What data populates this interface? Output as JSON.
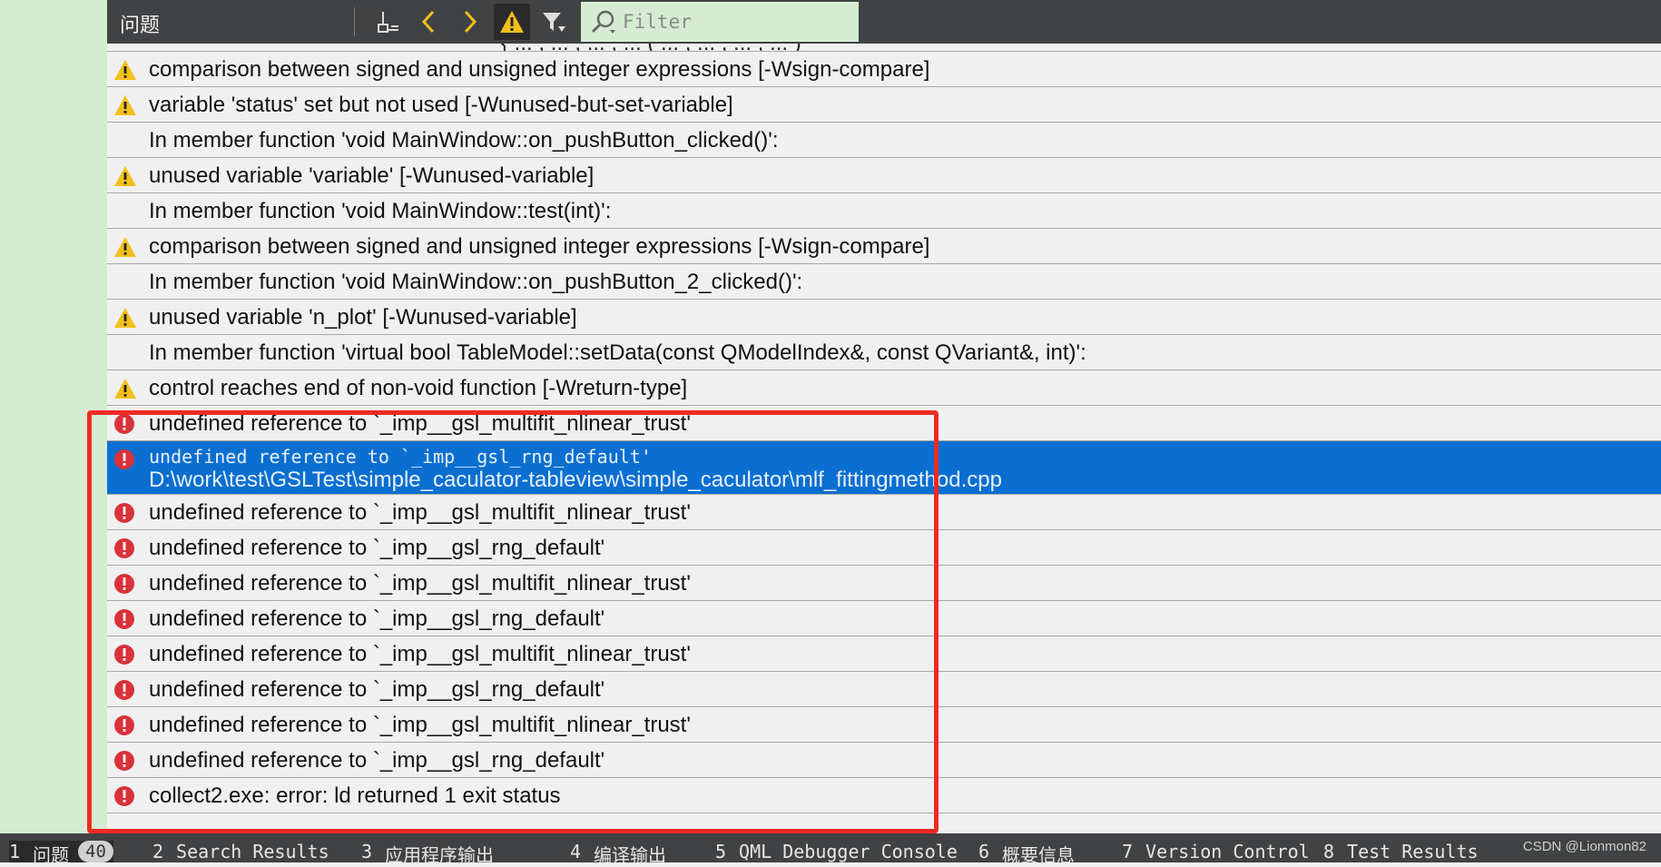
{
  "toolbar": {
    "title": "问题",
    "filter_placeholder": "Filter",
    "buttons": [
      "clean-icon",
      "chevron-left-icon",
      "chevron-right-icon",
      "warning-filter-icon",
      "filter-icon"
    ]
  },
  "issues": {
    "cutoff_text": "{  ...  ,  ...  ,  ...  ,  ...  (  ...  ,  ...  ,  ...  ,  ...  )",
    "rows": [
      {
        "type": "warning",
        "text": "comparison between signed and unsigned integer expressions [-Wsign-compare]"
      },
      {
        "type": "warning",
        "text": "variable 'status' set but not used [-Wunused-but-set-variable]"
      },
      {
        "type": "none",
        "text": "In member function 'void MainWindow::on_pushButton_clicked()':"
      },
      {
        "type": "warning",
        "text": "unused variable 'variable' [-Wunused-variable]"
      },
      {
        "type": "none",
        "text": "In member function 'void MainWindow::test(int)':"
      },
      {
        "type": "warning",
        "text": "comparison between signed and unsigned integer expressions [-Wsign-compare]"
      },
      {
        "type": "none",
        "text": "In member function 'void MainWindow::on_pushButton_2_clicked()':"
      },
      {
        "type": "warning",
        "text": "unused variable 'n_plot' [-Wunused-variable]"
      },
      {
        "type": "none",
        "text": "In member function 'virtual bool TableModel::setData(const QModelIndex&, const QVariant&, int)':"
      },
      {
        "type": "warning",
        "text": "control reaches end of non-void function [-Wreturn-type]"
      },
      {
        "type": "error",
        "text": "undefined reference to `_imp__gsl_multifit_nlinear_trust'"
      },
      {
        "type": "error",
        "selected": true,
        "text": "undefined reference to `_imp__gsl_rng_default'",
        "path": "D:\\work\\test\\GSLTest\\simple_caculator-tableview\\simple_caculator\\mlf_fittingmethod.cpp"
      },
      {
        "type": "error",
        "text": "undefined reference to `_imp__gsl_multifit_nlinear_trust'"
      },
      {
        "type": "error",
        "text": "undefined reference to `_imp__gsl_rng_default'"
      },
      {
        "type": "error",
        "text": "undefined reference to `_imp__gsl_multifit_nlinear_trust'"
      },
      {
        "type": "error",
        "text": "undefined reference to `_imp__gsl_rng_default'"
      },
      {
        "type": "error",
        "text": "undefined reference to `_imp__gsl_multifit_nlinear_trust'"
      },
      {
        "type": "error",
        "text": "undefined reference to `_imp__gsl_rng_default'"
      },
      {
        "type": "error",
        "text": "undefined reference to `_imp__gsl_multifit_nlinear_trust'"
      },
      {
        "type": "error",
        "text": "undefined reference to `_imp__gsl_rng_default'"
      },
      {
        "type": "error",
        "text": "collect2.exe: error: ld returned 1 exit status"
      }
    ]
  },
  "statusbar": {
    "tabs": [
      {
        "num": "1",
        "label": "问题",
        "badge": "40",
        "active": true
      },
      {
        "num": "2",
        "label": "Search Results"
      },
      {
        "num": "3",
        "label": "应用程序输出"
      },
      {
        "num": "4",
        "label": "编译输出"
      },
      {
        "num": "5",
        "label": "QML Debugger Console"
      },
      {
        "num": "6",
        "label": "概要信息"
      },
      {
        "num": "7",
        "label": "Version Control"
      },
      {
        "num": "8",
        "label": "Test Results"
      }
    ],
    "watermark": "CSDN @Lionmon82"
  },
  "colors": {
    "toolbar_bg": "#404244",
    "panel_bg": "#f0f0f0",
    "selection": "#0a6fd0",
    "warning": "#f2c01a",
    "error": "#d9323a",
    "highlight_box": "#ee2a24",
    "filter_bg": "#d6ecd2"
  }
}
